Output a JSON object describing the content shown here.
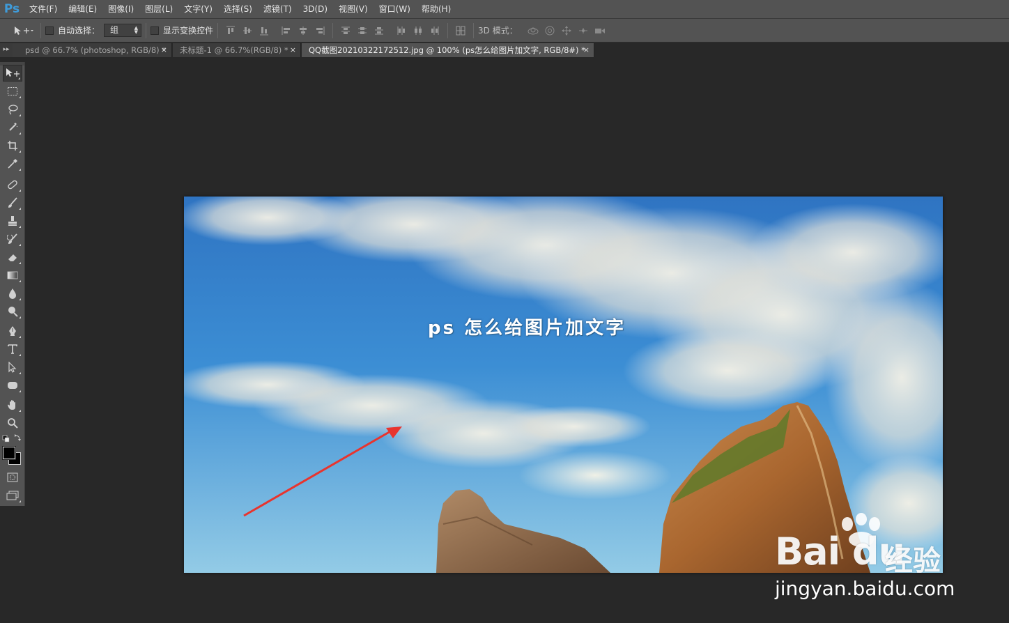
{
  "app": {
    "logo": "Ps"
  },
  "menu": [
    "文件(F)",
    "编辑(E)",
    "图像(I)",
    "图层(L)",
    "文字(Y)",
    "选择(S)",
    "滤镜(T)",
    "3D(D)",
    "视图(V)",
    "窗口(W)",
    "帮助(H)"
  ],
  "options": {
    "auto_select_label": "自动选择：",
    "auto_select_value": "组",
    "show_transform_label": "显示变换控件",
    "mode_3d_label": "3D 模式："
  },
  "tabs": [
    {
      "title": "psd @ 66.7% (photoshop, RGB/8) *",
      "close": "×"
    },
    {
      "title": "未标题-1 @ 66.7%(RGB/8) *",
      "close": "×"
    },
    {
      "title": "QQ截图20210322172512.jpg @ 100% (ps怎么给图片加文字, RGB/8#) *",
      "close": "×"
    }
  ],
  "canvas": {
    "overlay_text": "ps 怎么给图片加文字"
  },
  "watermark": {
    "logo": "Bai du",
    "text": "经验",
    "url": "jingyan.baidu.com"
  },
  "colors": {
    "accent": "#3f9bd9",
    "arrow": "#e8342e",
    "sky_top": "#3a7cc6",
    "sky_bottom": "#8cc6e6"
  }
}
